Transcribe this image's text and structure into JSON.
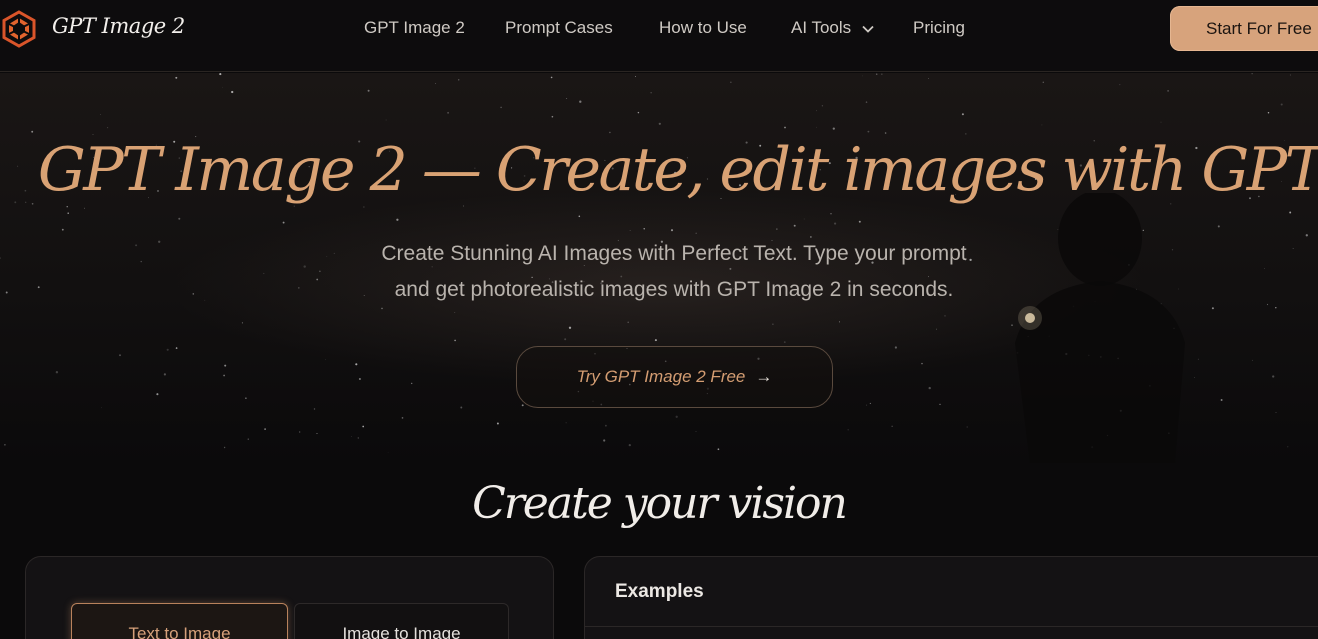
{
  "header": {
    "brand": "GPT Image 2",
    "nav": [
      {
        "label": "GPT Image 2"
      },
      {
        "label": "Prompt Cases"
      },
      {
        "label": "How to Use"
      },
      {
        "label": "AI Tools",
        "has_dropdown": true
      },
      {
        "label": "Pricing"
      }
    ],
    "cta_label": "Start For Free"
  },
  "hero": {
    "title": "GPT Image 2 — Create, edit images with GPT",
    "subtitle_line1": "Create Stunning AI Images with Perfect Text. Type your prompt",
    "subtitle_line2": "and get photorealistic images with GPT Image 2 in seconds.",
    "button_label": "Try GPT Image 2 Free",
    "button_arrow": "→"
  },
  "section": {
    "title": "Create your vision",
    "tabs": [
      {
        "label": "Text to Image",
        "active": true
      },
      {
        "label": "Image to Image",
        "active": false
      }
    ],
    "examples_title": "Examples"
  },
  "colors": {
    "accent": "#d9a274",
    "cta_bg": "#d7a37c",
    "background": "#0b0a0b"
  },
  "icons": {
    "logo": "geometric-logo-icon",
    "dropdown": "chevron-down-icon",
    "arrow": "arrow-right-icon"
  }
}
